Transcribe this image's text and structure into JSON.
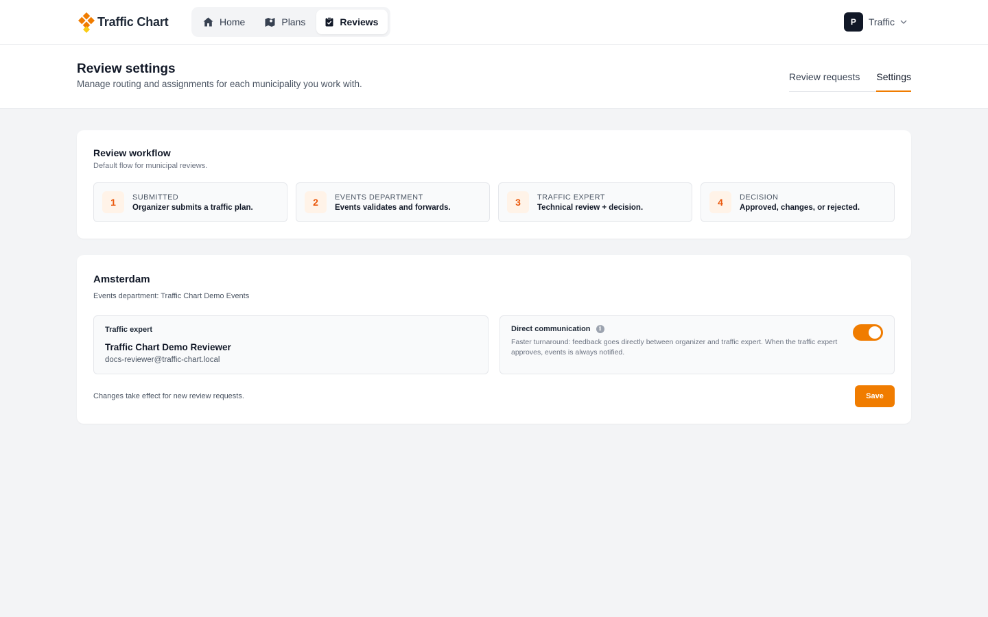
{
  "app": {
    "name": "Traffic Chart"
  },
  "nav": {
    "items": [
      {
        "label": "Home",
        "icon": "home-icon"
      },
      {
        "label": "Plans",
        "icon": "map-icon"
      },
      {
        "label": "Reviews",
        "icon": "clipboard-check-icon",
        "active": true
      }
    ]
  },
  "account": {
    "initial": "P",
    "name": "Traffic"
  },
  "header": {
    "title": "Review settings",
    "subtitle": "Manage routing and assignments for each municipality you work with.",
    "tabs": [
      {
        "label": "Review requests",
        "active": false
      },
      {
        "label": "Settings",
        "active": true
      }
    ]
  },
  "workflow": {
    "title": "Review workflow",
    "subtitle": "Default flow for municipal reviews.",
    "steps": [
      {
        "number": "1",
        "label": "Submitted",
        "description": "Organizer submits a traffic plan."
      },
      {
        "number": "2",
        "label": "Events department",
        "description": "Events validates and forwards."
      },
      {
        "number": "3",
        "label": "Traffic expert",
        "description": "Technical review + decision."
      },
      {
        "number": "4",
        "label": "Decision",
        "description": "Approved, changes, or rejected."
      }
    ]
  },
  "municipality": {
    "name": "Amsterdam",
    "department": "Events department: Traffic Chart Demo Events",
    "expert": {
      "label": "Traffic expert",
      "name": "Traffic Chart Demo Reviewer",
      "email": "docs-reviewer@traffic-chart.local"
    },
    "direct_communication": {
      "label": "Direct communication",
      "description": "Faster turnaround: feedback goes directly between organizer and traffic expert. When the traffic expert approves, events is always notified.",
      "enabled": true
    },
    "footnote": "Changes take effect for new review requests.",
    "save_label": "Save"
  },
  "colors": {
    "accent": "#f07c00",
    "step_number": "#ea580c",
    "avatar_bg": "#111827"
  }
}
